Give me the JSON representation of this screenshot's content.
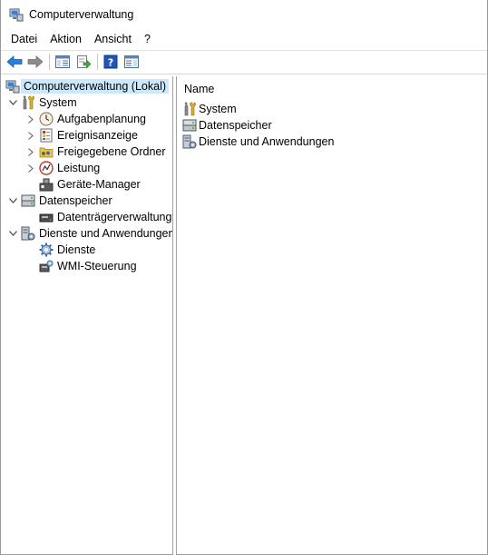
{
  "window": {
    "title": "Computerverwaltung"
  },
  "menu": {
    "items": [
      "Datei",
      "Aktion",
      "Ansicht",
      "?"
    ]
  },
  "toolbar": {
    "buttons": [
      "back-icon",
      "forward-icon",
      "show-hide-tree-icon",
      "export-list-icon",
      "help-icon",
      "show-hide-action-pane-icon"
    ]
  },
  "tree": {
    "root": {
      "label": "Computerverwaltung (Lokal)"
    },
    "system": {
      "label": "System",
      "children": [
        "Aufgabenplanung",
        "Ereignisanzeige",
        "Freigegebene Ordner",
        "Leistung",
        "Geräte-Manager"
      ]
    },
    "storage": {
      "label": "Datenspeicher",
      "children": [
        "Datenträgerverwaltung"
      ]
    },
    "services": {
      "label": "Dienste und Anwendungen",
      "children": [
        "Dienste",
        "WMI-Steuerung"
      ]
    }
  },
  "list": {
    "column_header": "Name",
    "items": [
      "System",
      "Datenspeicher",
      "Dienste und Anwendungen"
    ]
  },
  "colors": {
    "selection": "#cce8ff",
    "accent": "#1e6fd9"
  }
}
